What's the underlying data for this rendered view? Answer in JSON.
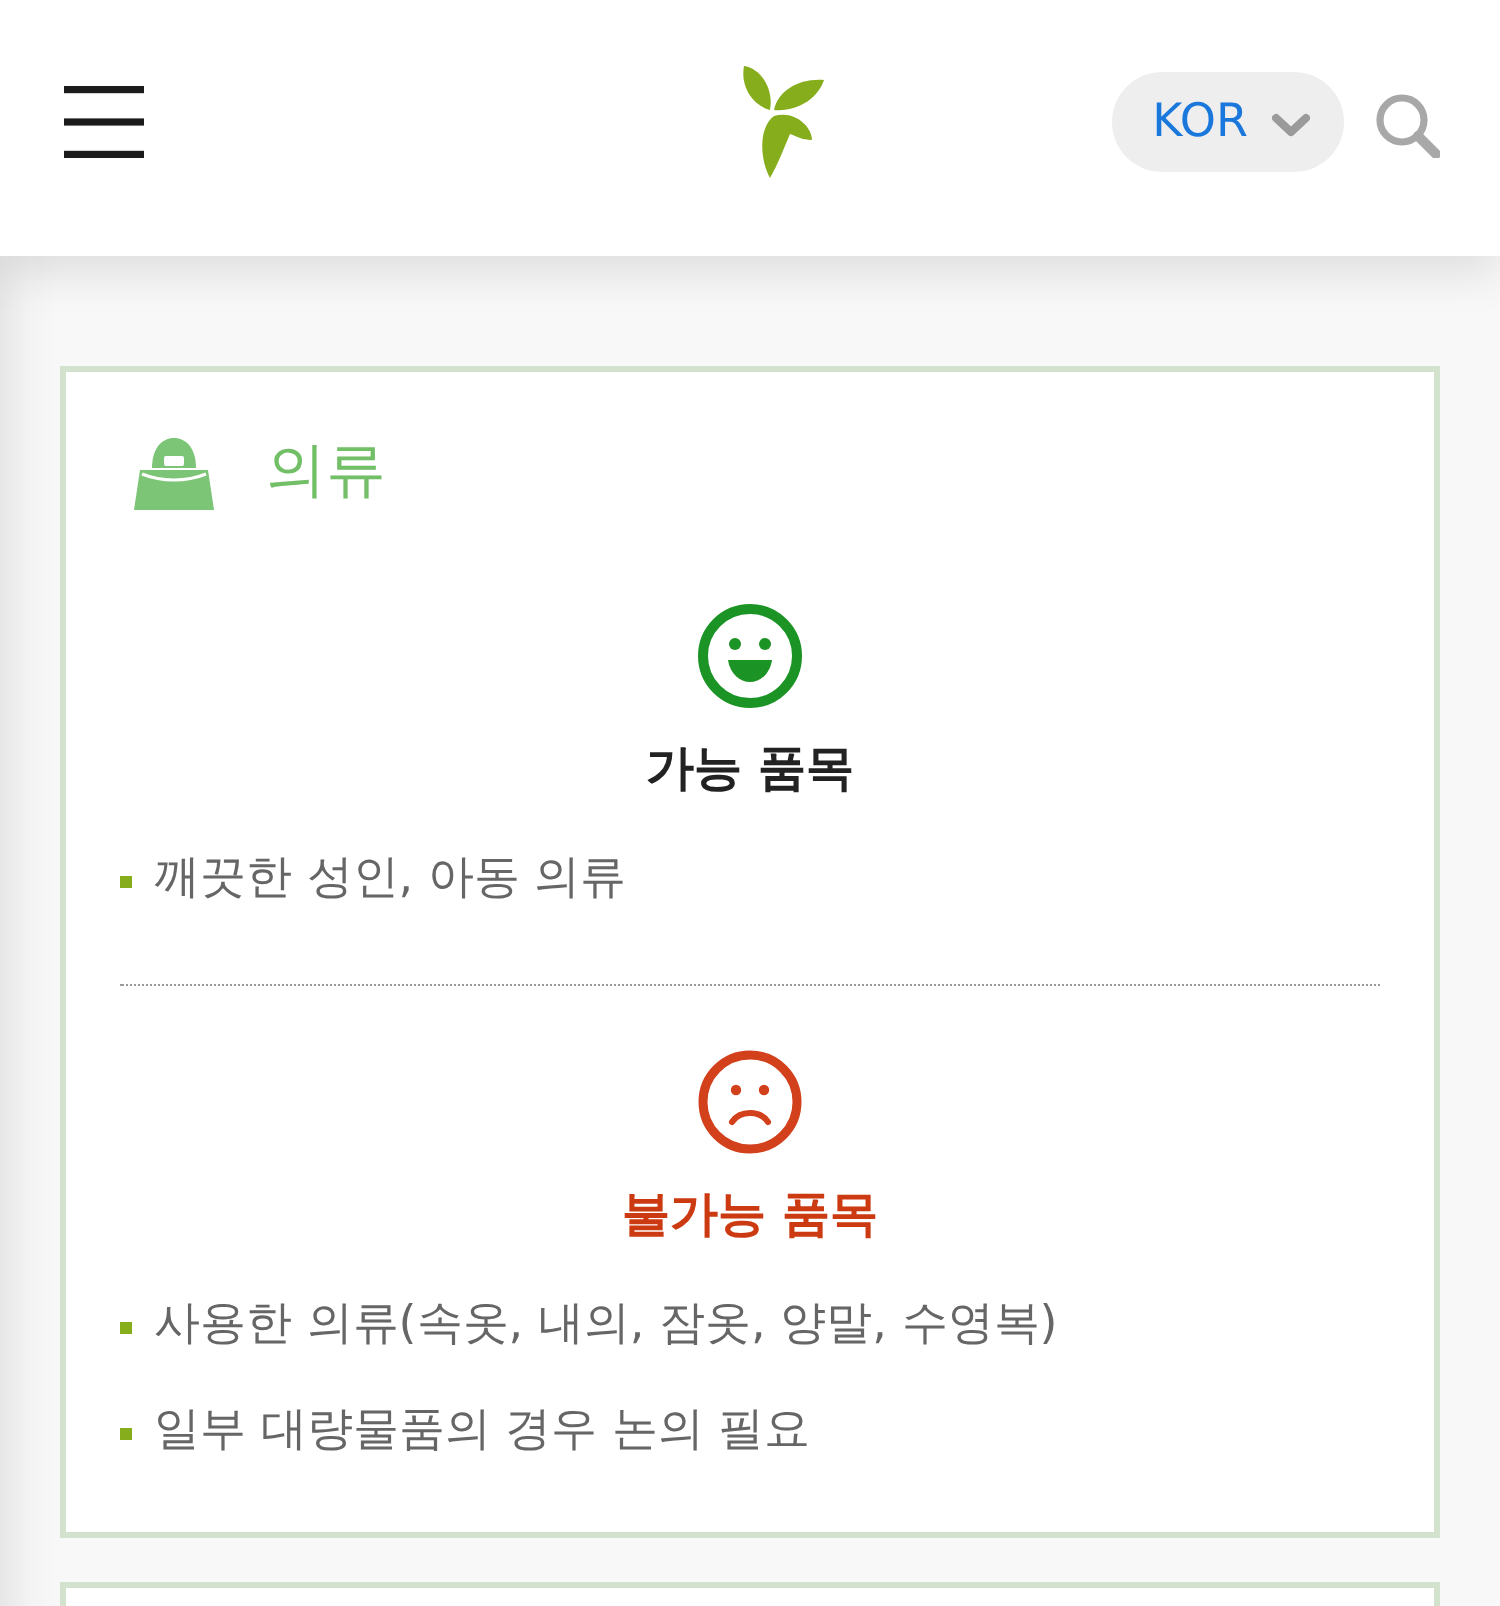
{
  "header": {
    "language": "KOR"
  },
  "categories": [
    {
      "title": "의류",
      "sections": [
        {
          "kind": "allowed",
          "heading": "가능 품목",
          "items": [
            "깨끗한 성인, 아동 의류"
          ]
        },
        {
          "kind": "forbidden",
          "heading": "불가능 품목",
          "items": [
            "사용한 의류(속옷, 내의, 잠옷, 양말, 수영복)",
            "일부 대량물품의 경우 논의 필요"
          ]
        }
      ]
    }
  ]
}
